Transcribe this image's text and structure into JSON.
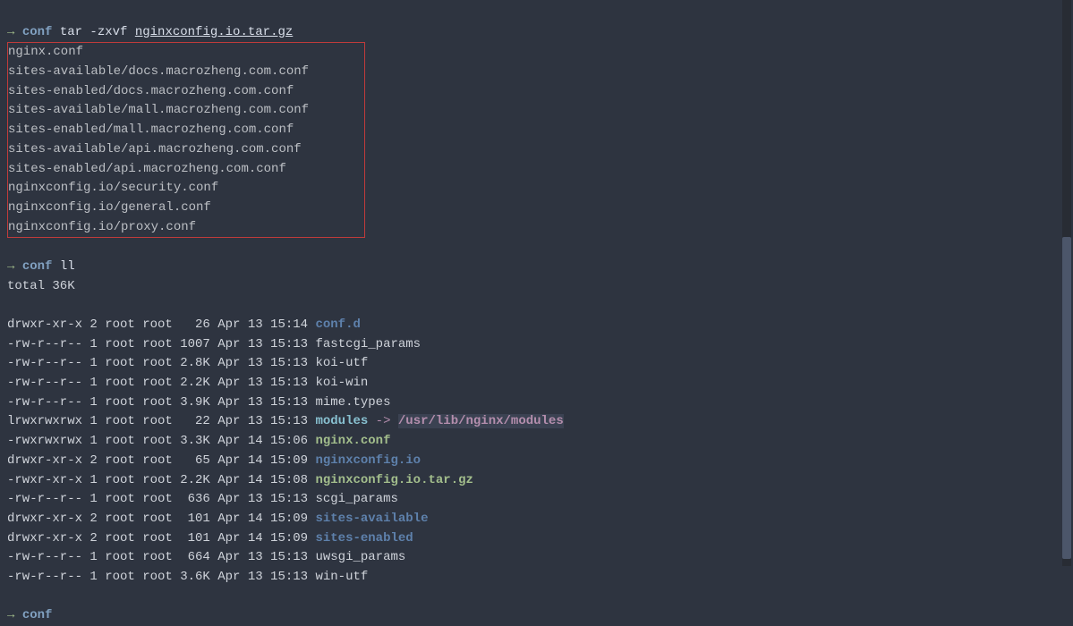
{
  "prompt1": {
    "arrow": "→",
    "path": "conf",
    "cmd": "tar -zxvf ",
    "arg": "nginxconfig.io.tar.gz"
  },
  "extracted": [
    "nginx.conf",
    "sites-available/docs.macrozheng.com.conf",
    "sites-enabled/docs.macrozheng.com.conf",
    "sites-available/mall.macrozheng.com.conf",
    "sites-enabled/mall.macrozheng.com.conf",
    "sites-available/api.macrozheng.com.conf",
    "sites-enabled/api.macrozheng.com.conf",
    "nginxconfig.io/security.conf",
    "nginxconfig.io/general.conf",
    "nginxconfig.io/proxy.conf"
  ],
  "prompt2": {
    "arrow": "→",
    "path": "conf",
    "cmd": "ll"
  },
  "total": "total 36K",
  "listing": [
    {
      "perm": "drwxr-xr-x",
      "n": "2",
      "o": "root",
      "g": "root",
      "size": "  26",
      "date": "Apr 13 15:14",
      "name": "conf.d",
      "type": "dir"
    },
    {
      "perm": "-rw-r--r--",
      "n": "1",
      "o": "root",
      "g": "root",
      "size": "1007",
      "date": "Apr 13 15:13",
      "name": "fastcgi_params",
      "type": "file"
    },
    {
      "perm": "-rw-r--r--",
      "n": "1",
      "o": "root",
      "g": "root",
      "size": "2.8K",
      "date": "Apr 13 15:13",
      "name": "koi-utf",
      "type": "file"
    },
    {
      "perm": "-rw-r--r--",
      "n": "1",
      "o": "root",
      "g": "root",
      "size": "2.2K",
      "date": "Apr 13 15:13",
      "name": "koi-win",
      "type": "file"
    },
    {
      "perm": "-rw-r--r--",
      "n": "1",
      "o": "root",
      "g": "root",
      "size": "3.9K",
      "date": "Apr 13 15:13",
      "name": "mime.types",
      "type": "file"
    },
    {
      "perm": "lrwxrwxrwx",
      "n": "1",
      "o": "root",
      "g": "root",
      "size": "  22",
      "date": "Apr 13 15:13",
      "name": "modules",
      "type": "link",
      "arrow": " -> ",
      "target": "/usr/lib/nginx/modules"
    },
    {
      "perm": "-rwxrwxrwx",
      "n": "1",
      "o": "root",
      "g": "root",
      "size": "3.3K",
      "date": "Apr 14 15:06",
      "name": "nginx.conf",
      "type": "exec"
    },
    {
      "perm": "drwxr-xr-x",
      "n": "2",
      "o": "root",
      "g": "root",
      "size": "  65",
      "date": "Apr 14 15:09",
      "name": "nginxconfig.io",
      "type": "dir"
    },
    {
      "perm": "-rwxr-xr-x",
      "n": "1",
      "o": "root",
      "g": "root",
      "size": "2.2K",
      "date": "Apr 14 15:08",
      "name": "nginxconfig.io.tar.gz",
      "type": "exec"
    },
    {
      "perm": "-rw-r--r--",
      "n": "1",
      "o": "root",
      "g": "root",
      "size": " 636",
      "date": "Apr 13 15:13",
      "name": "scgi_params",
      "type": "file"
    },
    {
      "perm": "drwxr-xr-x",
      "n": "2",
      "o": "root",
      "g": "root",
      "size": " 101",
      "date": "Apr 14 15:09",
      "name": "sites-available",
      "type": "dir"
    },
    {
      "perm": "drwxr-xr-x",
      "n": "2",
      "o": "root",
      "g": "root",
      "size": " 101",
      "date": "Apr 14 15:09",
      "name": "sites-enabled",
      "type": "dir"
    },
    {
      "perm": "-rw-r--r--",
      "n": "1",
      "o": "root",
      "g": "root",
      "size": " 664",
      "date": "Apr 13 15:13",
      "name": "uwsgi_params",
      "type": "file"
    },
    {
      "perm": "-rw-r--r--",
      "n": "1",
      "o": "root",
      "g": "root",
      "size": "3.6K",
      "date": "Apr 13 15:13",
      "name": "win-utf",
      "type": "file"
    }
  ],
  "prompt3": {
    "arrow": "→",
    "path": "conf"
  }
}
